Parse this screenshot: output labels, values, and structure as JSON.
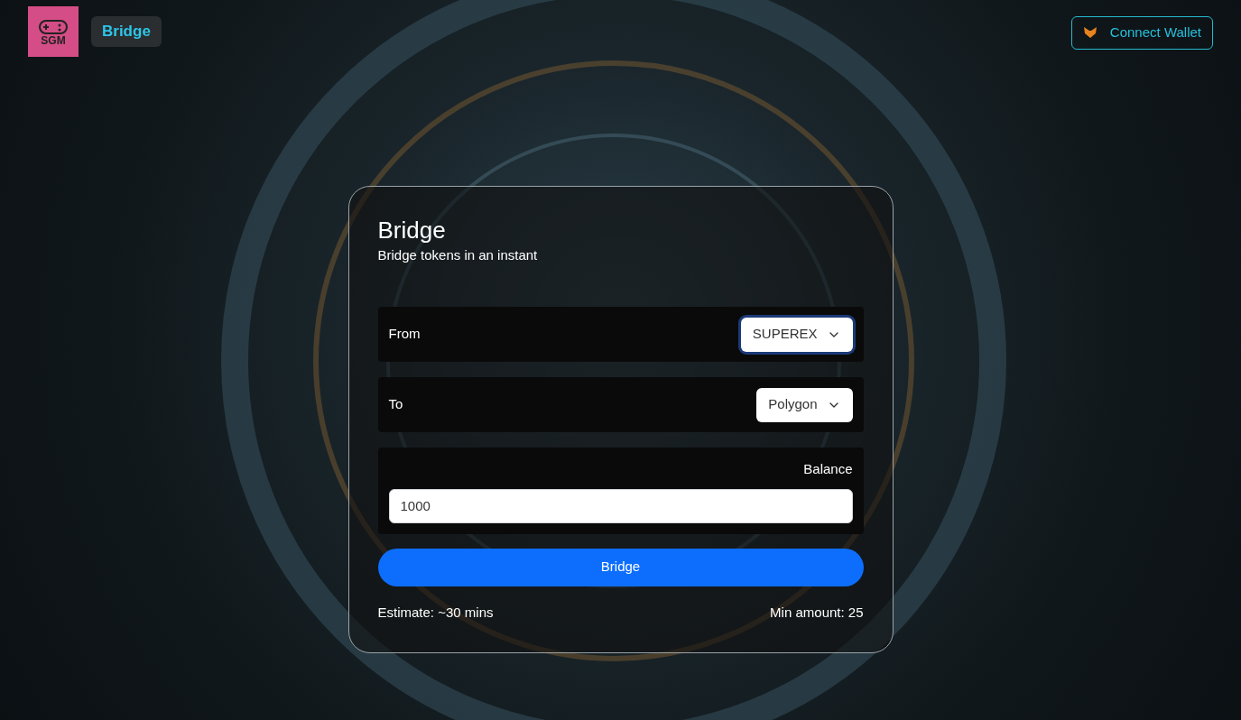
{
  "header": {
    "logo_text": "SGM",
    "nav_link": "Bridge",
    "connect_button": "Connect Wallet"
  },
  "card": {
    "title": "Bridge",
    "subtitle": "Bridge tokens in an instant",
    "selects": [
      {
        "label": "From",
        "value": "SUPEREX",
        "focused": true
      },
      {
        "label": "To",
        "value": "Polygon",
        "focused": false
      }
    ],
    "balance_label": "Balance",
    "amount_value": "1000",
    "submit": "Bridge",
    "estimate": "Estimate: ~30 mins",
    "min_amount": "Min amount: 25"
  }
}
